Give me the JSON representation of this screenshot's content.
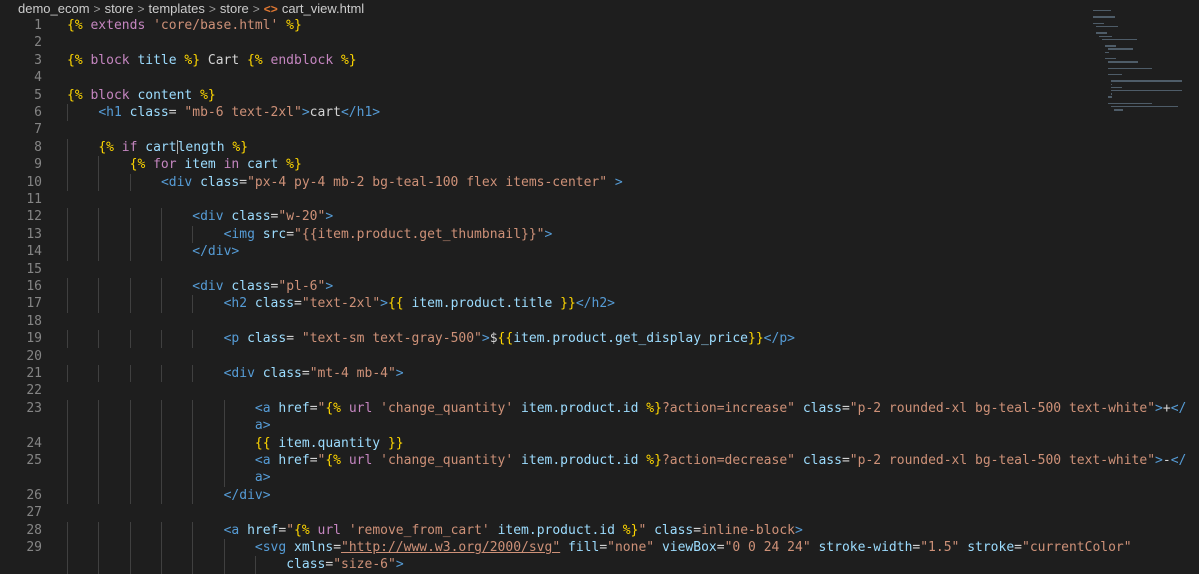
{
  "breadcrumb": {
    "items": [
      "demo_ecom",
      "store",
      "templates",
      "store",
      "cart_view.html"
    ],
    "separator": ">",
    "file_icon": "<>"
  },
  "colors": {
    "background": "#1e1e1e",
    "line_number": "#858585",
    "tag": "#569cd6",
    "attribute": "#9cdcfe",
    "string": "#ce9178",
    "template_delimiter": "#ffd700",
    "keyword": "#c586c0"
  },
  "code_lines": [
    {
      "n": "1",
      "indent": 0,
      "tokens": [
        [
          "tpl",
          "{% "
        ],
        [
          "kw",
          "extends "
        ],
        [
          "str",
          "'core/base.html'"
        ],
        [
          "tpl",
          " %}"
        ]
      ]
    },
    {
      "n": "2",
      "indent": 0,
      "tokens": []
    },
    {
      "n": "3",
      "indent": 0,
      "tokens": [
        [
          "tpl",
          "{% "
        ],
        [
          "kw",
          "block "
        ],
        [
          "var",
          "title"
        ],
        [
          "tpl",
          " %}"
        ],
        [
          "plain",
          " Cart "
        ],
        [
          "tpl",
          "{% "
        ],
        [
          "kw",
          "endblock"
        ],
        [
          "tpl",
          " %}"
        ]
      ]
    },
    {
      "n": "4",
      "indent": 0,
      "tokens": []
    },
    {
      "n": "5",
      "indent": 0,
      "tokens": [
        [
          "tpl",
          "{% "
        ],
        [
          "kw",
          "block "
        ],
        [
          "var",
          "content"
        ],
        [
          "tpl",
          " %}"
        ]
      ]
    },
    {
      "n": "6",
      "indent": 1,
      "tokens": [
        [
          "tag",
          "<h1 "
        ],
        [
          "attr",
          "class"
        ],
        [
          "plain",
          "= "
        ],
        [
          "str",
          "\"mb-6 text-2xl\""
        ],
        [
          "tag",
          ">"
        ],
        [
          "plain",
          "cart"
        ],
        [
          "tag",
          "</h1>"
        ]
      ]
    },
    {
      "n": "7",
      "indent": 0,
      "tokens": []
    },
    {
      "n": "8",
      "indent": 1,
      "tokens": [
        [
          "tpl",
          "{% "
        ],
        [
          "kw",
          "if "
        ],
        [
          "var",
          "cart"
        ],
        [
          "cursor",
          ""
        ],
        [
          "var",
          "length"
        ],
        [
          "tpl",
          " %}"
        ]
      ]
    },
    {
      "n": "9",
      "indent": 2,
      "tokens": [
        [
          "tpl",
          "{% "
        ],
        [
          "kw",
          "for "
        ],
        [
          "var",
          "item "
        ],
        [
          "kw",
          "in "
        ],
        [
          "var",
          "cart"
        ],
        [
          "tpl",
          " %}"
        ]
      ]
    },
    {
      "n": "10",
      "indent": 3,
      "tokens": [
        [
          "tag",
          "<div "
        ],
        [
          "attr",
          "class"
        ],
        [
          "plain",
          "="
        ],
        [
          "str",
          "\"px-4 py-4 mb-2 bg-teal-100 flex items-center\""
        ],
        [
          "plain",
          " "
        ],
        [
          "tag",
          ">"
        ]
      ]
    },
    {
      "n": "11",
      "indent": 0,
      "tokens": []
    },
    {
      "n": "12",
      "indent": 4,
      "tokens": [
        [
          "tag",
          "<div "
        ],
        [
          "attr",
          "class"
        ],
        [
          "plain",
          "="
        ],
        [
          "str",
          "\"w-20\""
        ],
        [
          "tag",
          ">"
        ]
      ]
    },
    {
      "n": "13",
      "indent": 5,
      "tokens": [
        [
          "tag",
          "<img "
        ],
        [
          "attr",
          "src"
        ],
        [
          "plain",
          "="
        ],
        [
          "str",
          "\"{{item.product.get_thumbnail}}\""
        ],
        [
          "tag",
          ">"
        ]
      ]
    },
    {
      "n": "14",
      "indent": 4,
      "tokens": [
        [
          "tag",
          "</div>"
        ]
      ]
    },
    {
      "n": "15",
      "indent": 0,
      "tokens": []
    },
    {
      "n": "16",
      "indent": 4,
      "tokens": [
        [
          "tag",
          "<div "
        ],
        [
          "attr",
          "class"
        ],
        [
          "plain",
          "="
        ],
        [
          "str",
          "\"pl-6\""
        ],
        [
          "tag",
          ">"
        ]
      ]
    },
    {
      "n": "17",
      "indent": 5,
      "tokens": [
        [
          "tag",
          "<h2 "
        ],
        [
          "attr",
          "class"
        ],
        [
          "plain",
          "="
        ],
        [
          "str",
          "\"text-2xl\""
        ],
        [
          "tag",
          ">"
        ],
        [
          "tpl",
          "{{ "
        ],
        [
          "var",
          "item.product.title"
        ],
        [
          "tpl",
          " }}"
        ],
        [
          "tag",
          "</h2>"
        ]
      ]
    },
    {
      "n": "18",
      "indent": 0,
      "tokens": []
    },
    {
      "n": "19",
      "indent": 5,
      "tokens": [
        [
          "tag",
          "<p "
        ],
        [
          "attr",
          "class"
        ],
        [
          "plain",
          "= "
        ],
        [
          "str",
          "\"text-sm text-gray-500\""
        ],
        [
          "tag",
          ">"
        ],
        [
          "plain",
          "$"
        ],
        [
          "tpl",
          "{{"
        ],
        [
          "var",
          "item.product.get_display_price"
        ],
        [
          "tpl",
          "}}"
        ],
        [
          "tag",
          "</p>"
        ]
      ]
    },
    {
      "n": "20",
      "indent": 0,
      "tokens": []
    },
    {
      "n": "21",
      "indent": 5,
      "tokens": [
        [
          "tag",
          "<div "
        ],
        [
          "attr",
          "class"
        ],
        [
          "plain",
          "="
        ],
        [
          "str",
          "\"mt-4 mb-4\""
        ],
        [
          "tag",
          ">"
        ]
      ]
    },
    {
      "n": "22",
      "indent": 0,
      "tokens": []
    },
    {
      "n": "23",
      "indent": 6,
      "tokens": [
        [
          "tag",
          "<a "
        ],
        [
          "attr",
          "href"
        ],
        [
          "plain",
          "="
        ],
        [
          "str",
          "\""
        ],
        [
          "tpl",
          "{% "
        ],
        [
          "kw",
          "url "
        ],
        [
          "str",
          "'change_quantity' "
        ],
        [
          "var",
          "item.product.id"
        ],
        [
          "tpl",
          " %}"
        ],
        [
          "str",
          "?action=increase\""
        ],
        [
          "plain",
          " "
        ],
        [
          "attr",
          "class"
        ],
        [
          "plain",
          "="
        ],
        [
          "str",
          "\"p-2 rounded-xl bg-teal-500 text-white\""
        ],
        [
          "tag",
          ">"
        ],
        [
          "plain",
          "+"
        ],
        [
          "tag",
          "</"
        ]
      ]
    },
    {
      "n": "",
      "indent": 6,
      "tokens": [
        [
          "tag",
          "a>"
        ]
      ]
    },
    {
      "n": "24",
      "indent": 6,
      "tokens": [
        [
          "tpl",
          "{{ "
        ],
        [
          "var",
          "item.quantity"
        ],
        [
          "tpl",
          " }}"
        ]
      ]
    },
    {
      "n": "25",
      "indent": 6,
      "tokens": [
        [
          "tag",
          "<a "
        ],
        [
          "attr",
          "href"
        ],
        [
          "plain",
          "="
        ],
        [
          "str",
          "\""
        ],
        [
          "tpl",
          "{% "
        ],
        [
          "kw",
          "url "
        ],
        [
          "str",
          "'change_quantity' "
        ],
        [
          "var",
          "item.product.id"
        ],
        [
          "tpl",
          " %}"
        ],
        [
          "str",
          "?action=decrease\""
        ],
        [
          "plain",
          " "
        ],
        [
          "attr",
          "class"
        ],
        [
          "plain",
          "="
        ],
        [
          "str",
          "\"p-2 rounded-xl bg-teal-500 text-white\""
        ],
        [
          "tag",
          ">"
        ],
        [
          "plain",
          "-"
        ],
        [
          "tag",
          "</"
        ]
      ]
    },
    {
      "n": "",
      "indent": 6,
      "tokens": [
        [
          "tag",
          "a>"
        ]
      ]
    },
    {
      "n": "26",
      "indent": 5,
      "tokens": [
        [
          "tag",
          "</div>"
        ]
      ]
    },
    {
      "n": "27",
      "indent": 0,
      "tokens": []
    },
    {
      "n": "28",
      "indent": 5,
      "tokens": [
        [
          "tag",
          "<a "
        ],
        [
          "attr",
          "href"
        ],
        [
          "plain",
          "="
        ],
        [
          "str",
          "\""
        ],
        [
          "tpl",
          "{% "
        ],
        [
          "kw",
          "url "
        ],
        [
          "str",
          "'remove_from_cart' "
        ],
        [
          "var",
          "item.product.id"
        ],
        [
          "tpl",
          " %}"
        ],
        [
          "str",
          "\""
        ],
        [
          "plain",
          " "
        ],
        [
          "attr",
          "class"
        ],
        [
          "plain",
          "="
        ],
        [
          "str",
          "inline-block"
        ],
        [
          "tag",
          ">"
        ]
      ]
    },
    {
      "n": "29",
      "indent": 6,
      "tokens": [
        [
          "tag",
          "<svg "
        ],
        [
          "attr",
          "xmlns"
        ],
        [
          "plain",
          "="
        ],
        [
          "url",
          "\"http://www.w3.org/2000/svg\""
        ],
        [
          "plain",
          " "
        ],
        [
          "attr",
          "fill"
        ],
        [
          "plain",
          "="
        ],
        [
          "str",
          "\"none\""
        ],
        [
          "plain",
          " "
        ],
        [
          "attr",
          "viewBox"
        ],
        [
          "plain",
          "="
        ],
        [
          "str",
          "\"0 0 24 24\""
        ],
        [
          "plain",
          " "
        ],
        [
          "attr",
          "stroke-width"
        ],
        [
          "plain",
          "="
        ],
        [
          "str",
          "\"1.5\""
        ],
        [
          "plain",
          " "
        ],
        [
          "attr",
          "stroke"
        ],
        [
          "plain",
          "="
        ],
        [
          "str",
          "\"currentColor\""
        ]
      ]
    },
    {
      "n": "",
      "indent": 7,
      "tokens": [
        [
          "attr",
          "class"
        ],
        [
          "plain",
          "="
        ],
        [
          "str",
          "\"size-6\""
        ],
        [
          "tag",
          ">"
        ]
      ]
    }
  ]
}
